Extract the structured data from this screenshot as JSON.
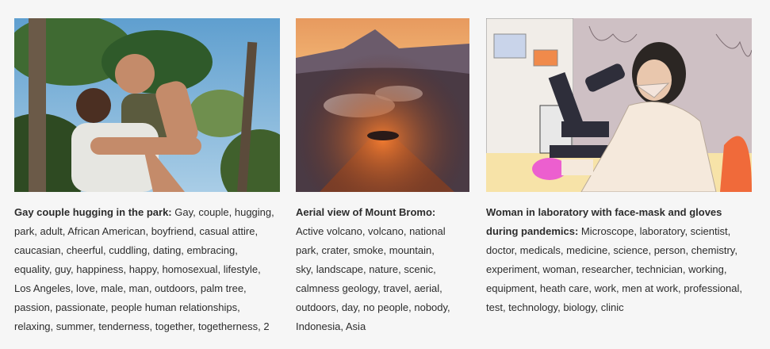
{
  "cards": [
    {
      "image_alt": "Gay couple hugging in the park",
      "title": "Gay couple hugging in the park:",
      "keywords": " Gay, couple, hugging, park, adult, African American, boyfriend, casual attire, caucasian, cheerful, cuddling, dating, embracing, equality, guy, happiness, happy, homosexual, lifestyle, Los Angeles, love, male, man, outdoors, palm tree, passion, passionate, people human relationships, relaxing, summer, tenderness, together, togetherness, 2"
    },
    {
      "image_alt": "Aerial view of Mount Bromo",
      "title": "Aerial view of Mount Bromo:",
      "keywords": " Active volcano, volcano, national park, crater, smoke, mountain, sky, landscape, nature, scenic, calmness geology, travel, aerial, outdoors, day, no people, nobody, Indonesia, Asia"
    },
    {
      "image_alt": "Woman in laboratory with face-mask and gloves",
      "title": "Woman in laboratory with face-mask and gloves during pandemics:",
      "keywords": " Microscope, laboratory, scientist, doctor, medicals, medicine, science, person, chemistry, experiment, woman, researcher, technician, working, equipment, heath care, work, men at work, professional, test, technology, biology, clinic"
    }
  ]
}
